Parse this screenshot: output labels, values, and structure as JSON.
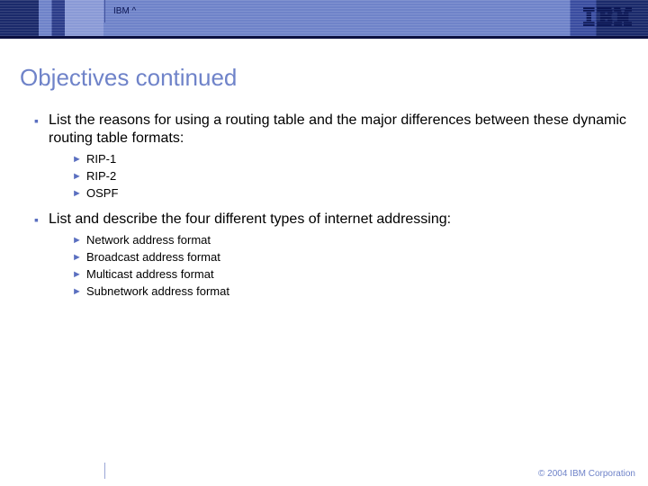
{
  "header": {
    "brand_label": "IBM ^",
    "logo_name": "IBM"
  },
  "title": "Objectives continued",
  "bullets": [
    {
      "text": "List the reasons for using a routing table and the major differences between these dynamic routing table formats:",
      "sub": [
        "RIP-1",
        "RIP-2",
        "OSPF"
      ]
    },
    {
      "text": "List and describe the four different types of internet addressing:",
      "sub": [
        "Network address format",
        "Broadcast address format",
        "Multicast address format",
        "Subnetwork address format"
      ]
    }
  ],
  "footer": {
    "copyright": "© 2004 IBM Corporation"
  }
}
